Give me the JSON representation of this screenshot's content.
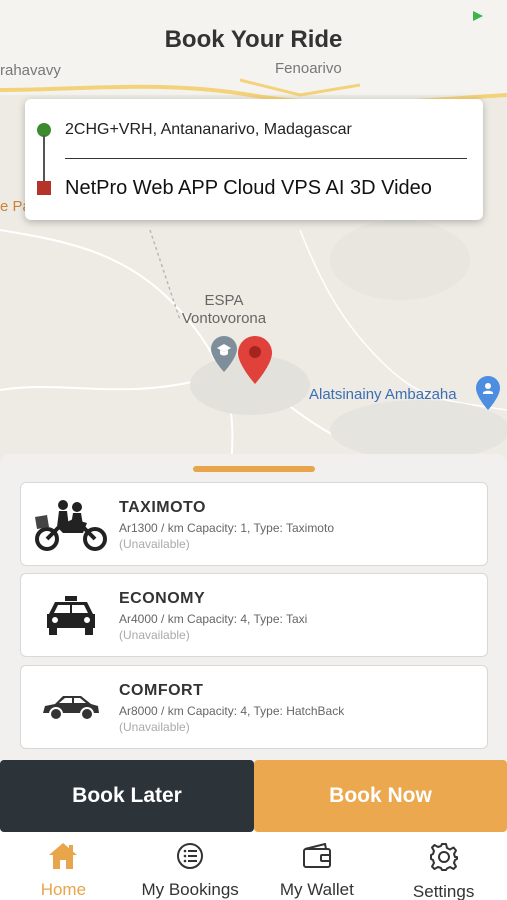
{
  "header": {
    "title": "Book Your Ride"
  },
  "map": {
    "labels": {
      "left_top": "rahavavy",
      "top_center": "Fenoarivo",
      "left_mid": "e Pa",
      "poi": "ESPA\nVontovorona",
      "place_right": "Alatsinainy Ambazaha"
    }
  },
  "route": {
    "pickup": "2CHG+VRH, Antananarivo, Madagascar",
    "dropoff": "NetPro Web APP Cloud VPS AI 3D Video"
  },
  "vehicles": [
    {
      "name": "TAXIMOTO",
      "detail": "Ar1300 / km  Capacity: 1, Type: Taximoto",
      "status": "(Unavailable)",
      "icon": "motorbike-icon"
    },
    {
      "name": "ECONOMY",
      "detail": "Ar4000 / km  Capacity: 4, Type: Taxi",
      "status": "(Unavailable)",
      "icon": "taxi-icon"
    },
    {
      "name": "COMFORT",
      "detail": "Ar8000 / km  Capacity: 4, Type: HatchBack",
      "status": "(Unavailable)",
      "icon": "car-icon"
    }
  ],
  "actions": {
    "book_later": "Book Later",
    "book_now": "Book Now"
  },
  "tabs": [
    {
      "label": "Home",
      "icon": "home-icon",
      "active": true
    },
    {
      "label": "My Bookings",
      "icon": "list-icon",
      "active": false
    },
    {
      "label": "My Wallet",
      "icon": "wallet-icon",
      "active": false
    },
    {
      "label": "Settings",
      "icon": "gear-icon",
      "active": false
    }
  ],
  "colors": {
    "accent": "#eca84e",
    "dark_button": "#2c3339",
    "pickup": "#3d8b2f",
    "dropoff": "#b5342a",
    "pin": "#e0413a"
  }
}
